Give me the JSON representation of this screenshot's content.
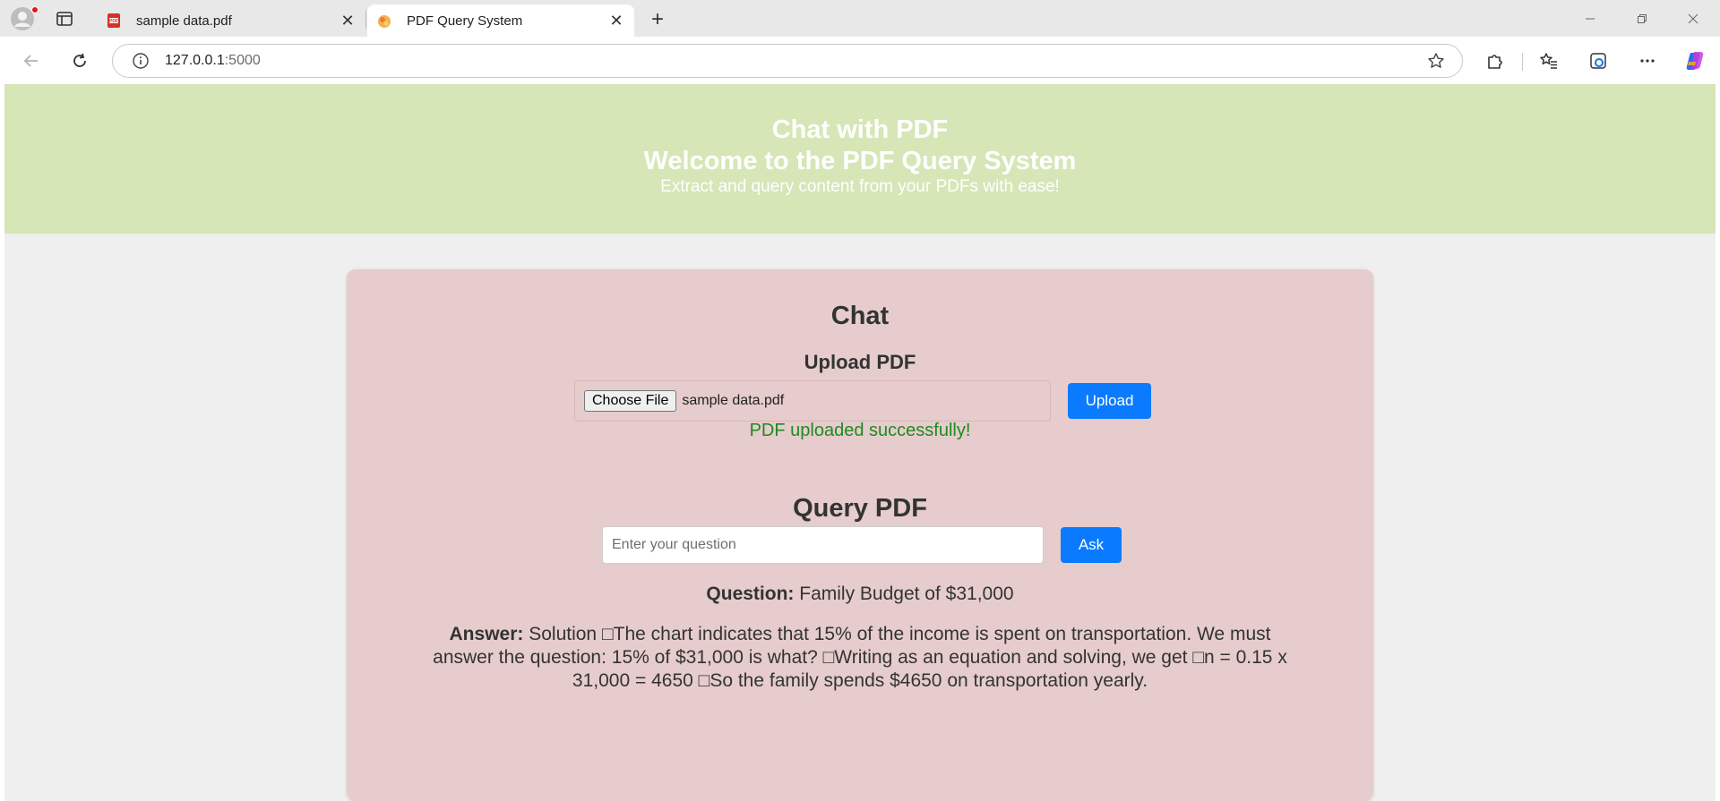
{
  "browser": {
    "tabs": [
      {
        "title": "sample data.pdf",
        "icon": "pdf-file-icon",
        "active": false
      },
      {
        "title": "PDF Query System",
        "icon": "site-favicon",
        "active": true
      }
    ],
    "address": {
      "host": "127.0.0.1",
      "port": ":5000"
    },
    "accent": "#0a7bff"
  },
  "header": {
    "title": "Chat with PDF",
    "welcome": "Welcome to the PDF Query System",
    "subtitle": "Extract and query content from your PDFs with ease!",
    "background": "#d6e6b7"
  },
  "chat": {
    "title": "Chat",
    "upload": {
      "title": "Upload PDF",
      "choose_label": "Choose File",
      "file_name": "sample data.pdf",
      "button_label": "Upload",
      "status": "PDF uploaded successfully!"
    },
    "query": {
      "title": "Query PDF",
      "placeholder": "Enter your question",
      "value": "",
      "button_label": "Ask"
    },
    "question_label": "Question:",
    "question_text": "Family Budget of $31,000",
    "answer_label": "Answer:",
    "answer_text": "Solution □The chart indicates that 15% of the income is spent on transportation. We must answer the question: 15% of $31,000 is what? □Writing as an equation and solving, we get □n = 0.15 x 31,000 = 4650 □So the family spends $4650 on transportation yearly.",
    "card_background": "#e6cccc"
  }
}
